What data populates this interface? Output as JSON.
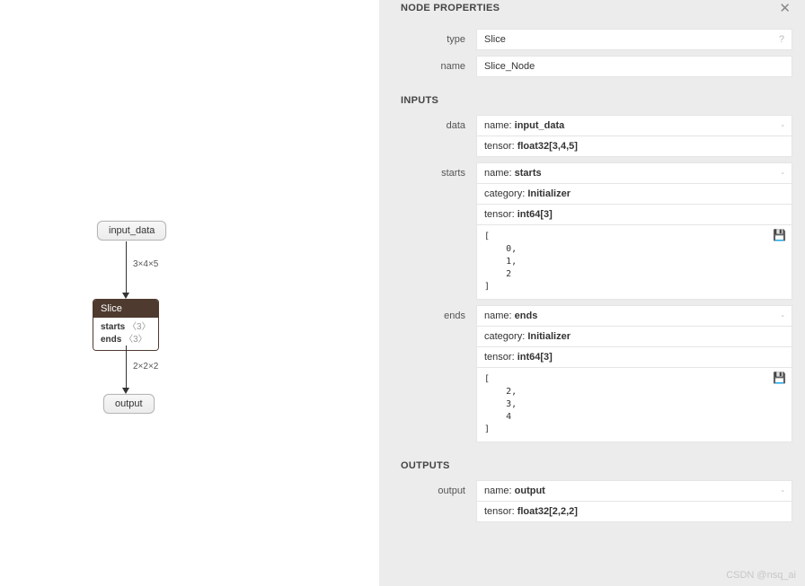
{
  "panel": {
    "title": "NODE PROPERTIES",
    "type_label": "type",
    "type_value": "Slice",
    "name_label": "name",
    "name_value": "Slice_Node",
    "inputs_header": "INPUTS",
    "outputs_header": "OUTPUTS"
  },
  "inputs": {
    "data": {
      "label": "data",
      "name_prefix": "name: ",
      "name_value": "input_data",
      "tensor_prefix": "tensor: ",
      "tensor_value": "float32[3,4,5]"
    },
    "starts": {
      "label": "starts",
      "name_prefix": "name: ",
      "name_value": "starts",
      "category_prefix": "category: ",
      "category_value": "Initializer",
      "tensor_prefix": "tensor: ",
      "tensor_value": "int64[3]",
      "values_text": "[\n    0,\n    1,\n    2\n]"
    },
    "ends": {
      "label": "ends",
      "name_prefix": "name: ",
      "name_value": "ends",
      "category_prefix": "category: ",
      "category_value": "Initializer",
      "tensor_prefix": "tensor: ",
      "tensor_value": "int64[3]",
      "values_text": "[\n    2,\n    3,\n    4\n]"
    }
  },
  "outputs": {
    "output": {
      "label": "output",
      "name_prefix": "name: ",
      "name_value": "output",
      "tensor_prefix": "tensor: ",
      "tensor_value": "float32[2,2,2]"
    }
  },
  "graph": {
    "input_node": "input_data",
    "edge1_label": "3×4×5",
    "op_name": "Slice",
    "op_line1_key": "starts",
    "op_line1_shape": "〈3〉",
    "op_line2_key": "ends",
    "op_line2_shape": "〈3〉",
    "edge2_label": "2×2×2",
    "output_node": "output"
  },
  "watermark": "CSDN @nsq_ai"
}
